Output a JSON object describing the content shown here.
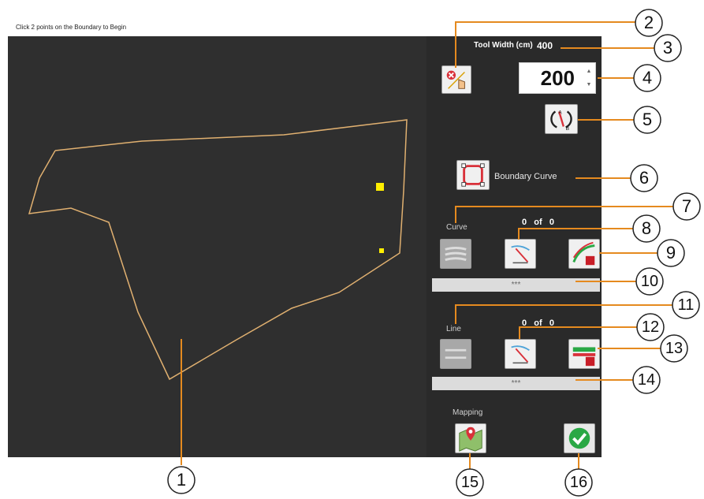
{
  "window": {
    "instruction": "Click 2 points on the Boundary to Begin"
  },
  "panel": {
    "tool_width_label": "Tool Width (cm)",
    "tool_width_value": "400",
    "numeric_value": "200",
    "boundary_curve_label": "Boundary Curve",
    "curve_label": "Curve",
    "curve_count": "0   of   0",
    "curve_bar": "***",
    "line_label": "Line",
    "line_count": "0   of   0",
    "line_bar": "***",
    "mapping_label": "Mapping"
  },
  "callouts": [
    "1",
    "2",
    "3",
    "4",
    "5",
    "6",
    "7",
    "8",
    "9",
    "10",
    "11",
    "12",
    "13",
    "14",
    "15",
    "16"
  ],
  "colors": {
    "map_bg": "#2f2f2f",
    "panel_bg": "#2a2a2a",
    "boundary": "#e0b070",
    "marker": "#ffee00",
    "callout_line": "#e58a1f",
    "ok_green": "#2aa845"
  },
  "icons": [
    "clear-points-icon",
    "ab-swap-icon",
    "boundary-curve-icon",
    "curve-list-icon",
    "curve-draw-icon",
    "curve-delete-icon",
    "line-list-icon",
    "line-draw-icon",
    "line-delete-icon",
    "mapping-icon",
    "ok-check-icon"
  ]
}
